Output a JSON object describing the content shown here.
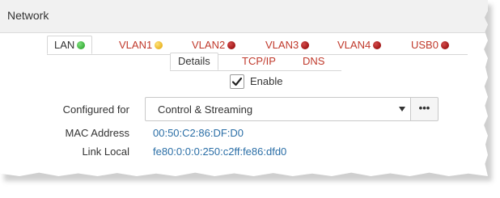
{
  "header": {
    "title": "Network"
  },
  "tabs": [
    {
      "label": "LAN",
      "status": "green"
    },
    {
      "label": "VLAN1",
      "status": "yellow"
    },
    {
      "label": "VLAN2",
      "status": "red"
    },
    {
      "label": "VLAN3",
      "status": "red"
    },
    {
      "label": "VLAN4",
      "status": "red"
    },
    {
      "label": "USB0",
      "status": "red"
    }
  ],
  "subtabs": [
    "Details",
    "TCP/IP",
    "DNS"
  ],
  "enable": {
    "label": "Enable",
    "checked": true
  },
  "configured_for": {
    "label": "Configured for",
    "value": "Control & Streaming",
    "more_label": "•••"
  },
  "mac": {
    "label": "MAC Address",
    "value": "00:50:C2:86:DF:D0"
  },
  "link_local": {
    "label": "Link Local",
    "value": "fe80:0:0:0:250:c2ff:fe86:dfd0"
  },
  "colors": {
    "tab_link": "#c0392b",
    "value_text": "#2a6ea6",
    "header_bg": "#f1f1f1"
  }
}
